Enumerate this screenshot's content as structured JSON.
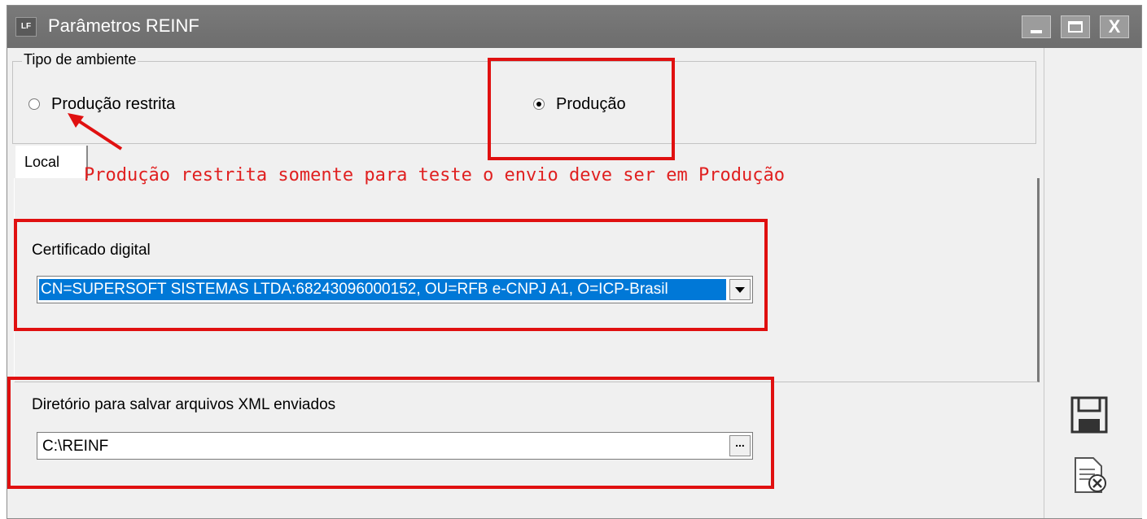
{
  "window": {
    "app_badge": "LF",
    "title": "Parâmetros REINF",
    "close_glyph": "X"
  },
  "ambiente": {
    "group_label": "Tipo de ambiente",
    "options": [
      {
        "label": "Produção restrita",
        "selected": false
      },
      {
        "label": "Produção",
        "selected": true
      }
    ]
  },
  "tabs": [
    {
      "label": "Local",
      "active": true
    }
  ],
  "annotation": {
    "text": "Produção restrita somente para  teste o envio deve ser em Produção",
    "color": "#e02020"
  },
  "certificado": {
    "label": "Certificado digital",
    "value": "CN=SUPERSOFT SISTEMAS LTDA:68243096000152, OU=RFB e-CNPJ A1, O=ICP-Brasil"
  },
  "diretorio": {
    "label": "Diretório para salvar arquivos XML enviados",
    "value": "C:\\REINF",
    "browse_label": "..."
  },
  "side_actions": [
    {
      "icon": "save-icon"
    },
    {
      "icon": "cancel-document-icon"
    }
  ],
  "colors": {
    "titlebar": "#6d6d6d",
    "highlight": "#0078d7",
    "redbox": "#e01010"
  }
}
